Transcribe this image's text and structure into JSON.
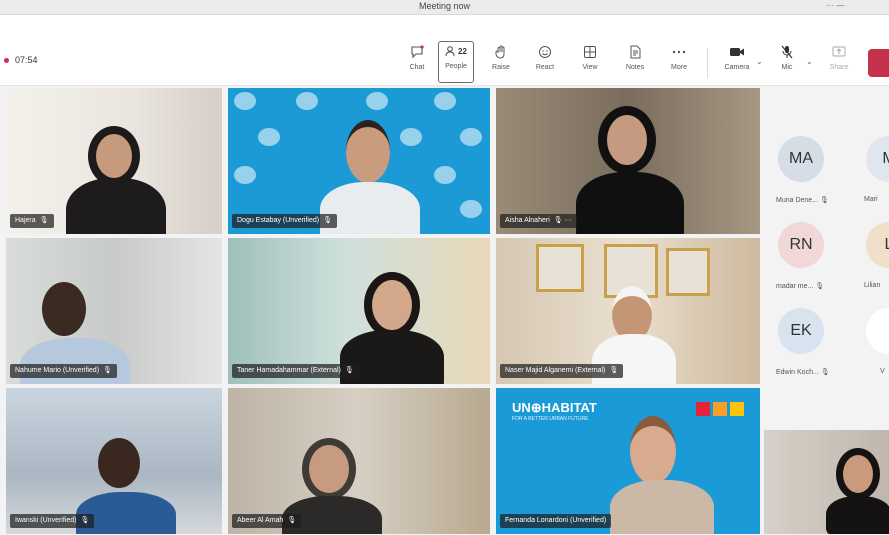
{
  "window": {
    "title": "Meeting now",
    "controls": "···    —"
  },
  "timer": "07:54",
  "toolbar": {
    "chat": "Chat",
    "people": "People",
    "people_count": "22",
    "raise": "Raise",
    "react": "React",
    "view": "View",
    "notes": "Notes",
    "more": "More",
    "camera": "Camera",
    "mic": "Mic",
    "share": "Share"
  },
  "tiles": [
    {
      "name": "Hajera",
      "bg": "#e6e2dc"
    },
    {
      "name": "Dogu Estabay (Unverified)",
      "bg": "#1c9ad6"
    },
    {
      "name": "Aisha Alnaheri",
      "bg": "#8f7f6c"
    },
    {
      "name": "Nahume Mario (Unverified)",
      "bg": "#cfd2d1"
    },
    {
      "name": "Taner Hamadahammar (External)",
      "bg": "#b9d0cc"
    },
    {
      "name": "Naser Majid Alganemi (External)",
      "bg": "#d9ccba"
    },
    {
      "name": "Iwanski (Unverified)",
      "bg": "#b8c6d1"
    },
    {
      "name": "Abeer Al Amah",
      "bg": "#cbc3b4"
    },
    {
      "name": "Fernanda Lonardoni (Unverified)",
      "bg": "#1a9bd7"
    }
  ],
  "roster": [
    {
      "initials": "MA",
      "label": "Muna Dene...",
      "color": "#d6dde6"
    },
    {
      "initials": "M",
      "label": "Mari",
      "color": "#dfe6ee"
    },
    {
      "initials": "RN",
      "label": "madar me...",
      "color": "#f2d7d9"
    },
    {
      "initials": "L",
      "label": "Lilian",
      "color": "#f1e0c9"
    },
    {
      "initials": "EK",
      "label": "Edwin Koch...",
      "color": "#d7e3ef"
    },
    {
      "initials": "",
      "label": "V",
      "color": "#ffffff"
    }
  ],
  "banner": {
    "brand": "UN⊕HABITAT",
    "tagline": "FOR A BETTER URBAN FUTURE"
  },
  "colors": {
    "accent": "#6264a7",
    "leave": "#c4314b",
    "un_blue": "#1c9ad6"
  }
}
